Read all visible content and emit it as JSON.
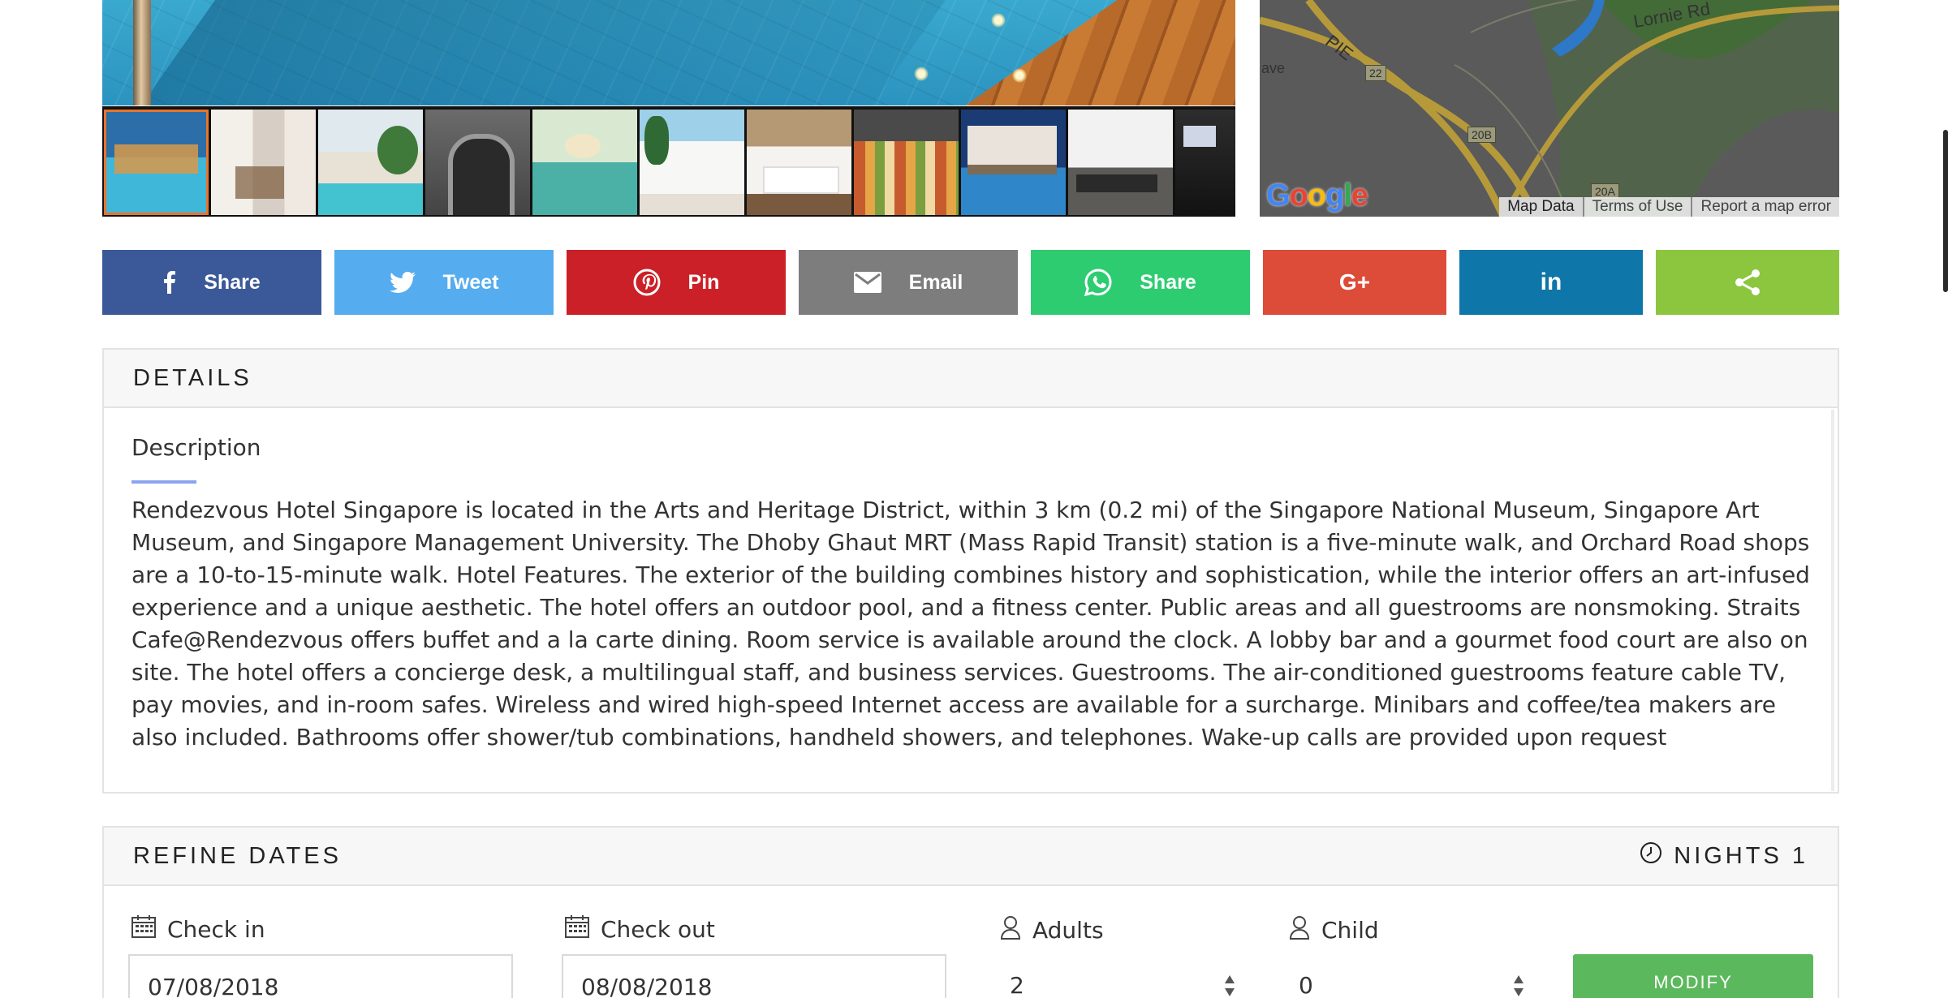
{
  "map": {
    "labels": {
      "road": "Lornie Rd",
      "expressway": "PIE",
      "edge": "ave"
    },
    "shields": [
      "22",
      "20B",
      "20A"
    ],
    "logo": "Google",
    "links": [
      "Map Data",
      "Terms of Use",
      "Report a map error"
    ]
  },
  "share": {
    "buttons": [
      {
        "label": "Share",
        "icon": "facebook-icon",
        "color": "#3b5998"
      },
      {
        "label": "Tweet",
        "icon": "twitter-icon",
        "color": "#55acee"
      },
      {
        "label": "Pin",
        "icon": "pinterest-icon",
        "color": "#cb2027"
      },
      {
        "label": "Email",
        "icon": "email-icon",
        "color": "#7d7d7d"
      },
      {
        "label": "Share",
        "icon": "whatsapp-icon",
        "color": "#2ecc71"
      },
      {
        "label": "",
        "icon": "google-plus-icon",
        "color": "#dd4b39"
      },
      {
        "label": "",
        "icon": "linkedin-icon",
        "color": "#0e76a8"
      },
      {
        "label": "",
        "icon": "share-icon",
        "color": "#8cc63f"
      }
    ]
  },
  "details": {
    "heading": "DETAILS",
    "description_title": "Description",
    "description": "Rendezvous Hotel Singapore is located in the Arts and Heritage District, within 3 km (0.2 mi) of the Singapore National Museum, Singapore Art Museum, and Singapore Management University. The Dhoby Ghaut MRT (Mass Rapid Transit) station is a five-minute walk, and Orchard Road shops are a 10-to-15-minute walk. Hotel Features. The exterior of the building combines history and sophistication, while the interior offers an art-infused experience and a unique aesthetic. The hotel offers an outdoor pool, and a fitness center. Public areas and all guestrooms are nonsmoking. Straits Cafe@Rendezvous offers buffet and a la carte dining. Room service is available around the clock. A lobby bar and a gourmet food court are also on site. The hotel offers a concierge desk, a multilingual staff, and business services. Guestrooms. The air-conditioned guestrooms feature cable TV, pay movies, and in-room safes. Wireless and wired high-speed Internet access are available for a surcharge. Minibars and coffee/tea makers are also included. Bathrooms offer shower/tub combinations, handheld showers, and telephones. Wake-up calls are provided upon request"
  },
  "refine": {
    "heading": "REFINE DATES",
    "nights_label": "NIGHTS 1",
    "check_in": {
      "label": "Check in",
      "value": "07/08/2018"
    },
    "check_out": {
      "label": "Check out",
      "value": "08/08/2018"
    },
    "adults": {
      "label": "Adults",
      "value": "2"
    },
    "child": {
      "label": "Child",
      "value": "0"
    },
    "modify_label": "MODIFY"
  }
}
